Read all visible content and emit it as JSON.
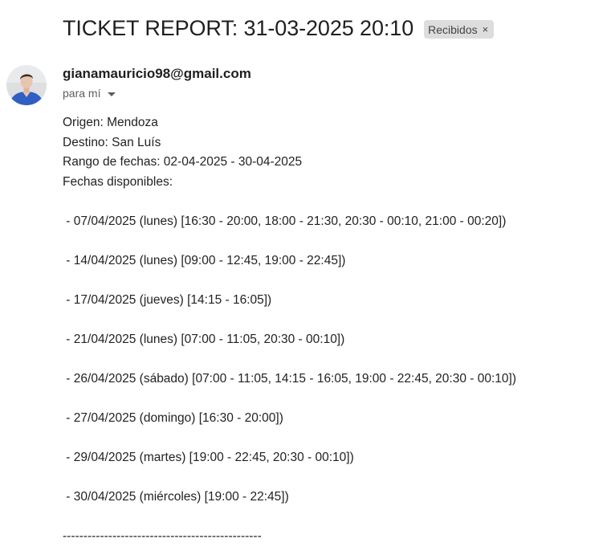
{
  "email": {
    "subject": "TICKET REPORT: 31-03-2025 20:10",
    "label": "Recibidos",
    "label_close": "×",
    "sender": "gianamauricio98@gmail.com",
    "recipient": "para mí",
    "body": {
      "origin": "Origen: Mendoza",
      "destination": "Destino: San Luís",
      "date_range": "Rango de fechas: 02-04-2025 - 30-04-2025",
      "available_heading": "Fechas disponibles:",
      "dates": [
        " - 07/04/2025 (lunes) [16:30 - 20:00, 18:00 - 21:30, 20:30 - 00:10, 21:00 - 00:20])",
        " - 14/04/2025 (lunes) [09:00 - 12:45, 19:00 - 22:45])",
        " - 17/04/2025 (jueves) [14:15 - 16:05])",
        " - 21/04/2025 (lunes) [07:00 - 11:05, 20:30 - 00:10])",
        " - 26/04/2025 (sábado) [07:00 - 11:05, 14:15 - 16:05, 19:00 - 22:45, 20:30 - 00:10])",
        " - 27/04/2025 (domingo) [16:30 - 20:00])",
        " - 29/04/2025 (martes) [19:00 - 22:45, 20:30 - 00:10])",
        " - 30/04/2025 (miércoles) [19:00 - 22:45])"
      ],
      "separator": "------------------------------------------------"
    }
  },
  "colors": {
    "label_chip_bg": "#dddddd",
    "avatar_shirt": "#2f5fc4",
    "text": "#222222",
    "muted": "#5e5e5e"
  },
  "icons": {
    "avatar": "avatar-photo",
    "label_close": "close-icon",
    "recipient_toggle": "caret-down-icon"
  }
}
